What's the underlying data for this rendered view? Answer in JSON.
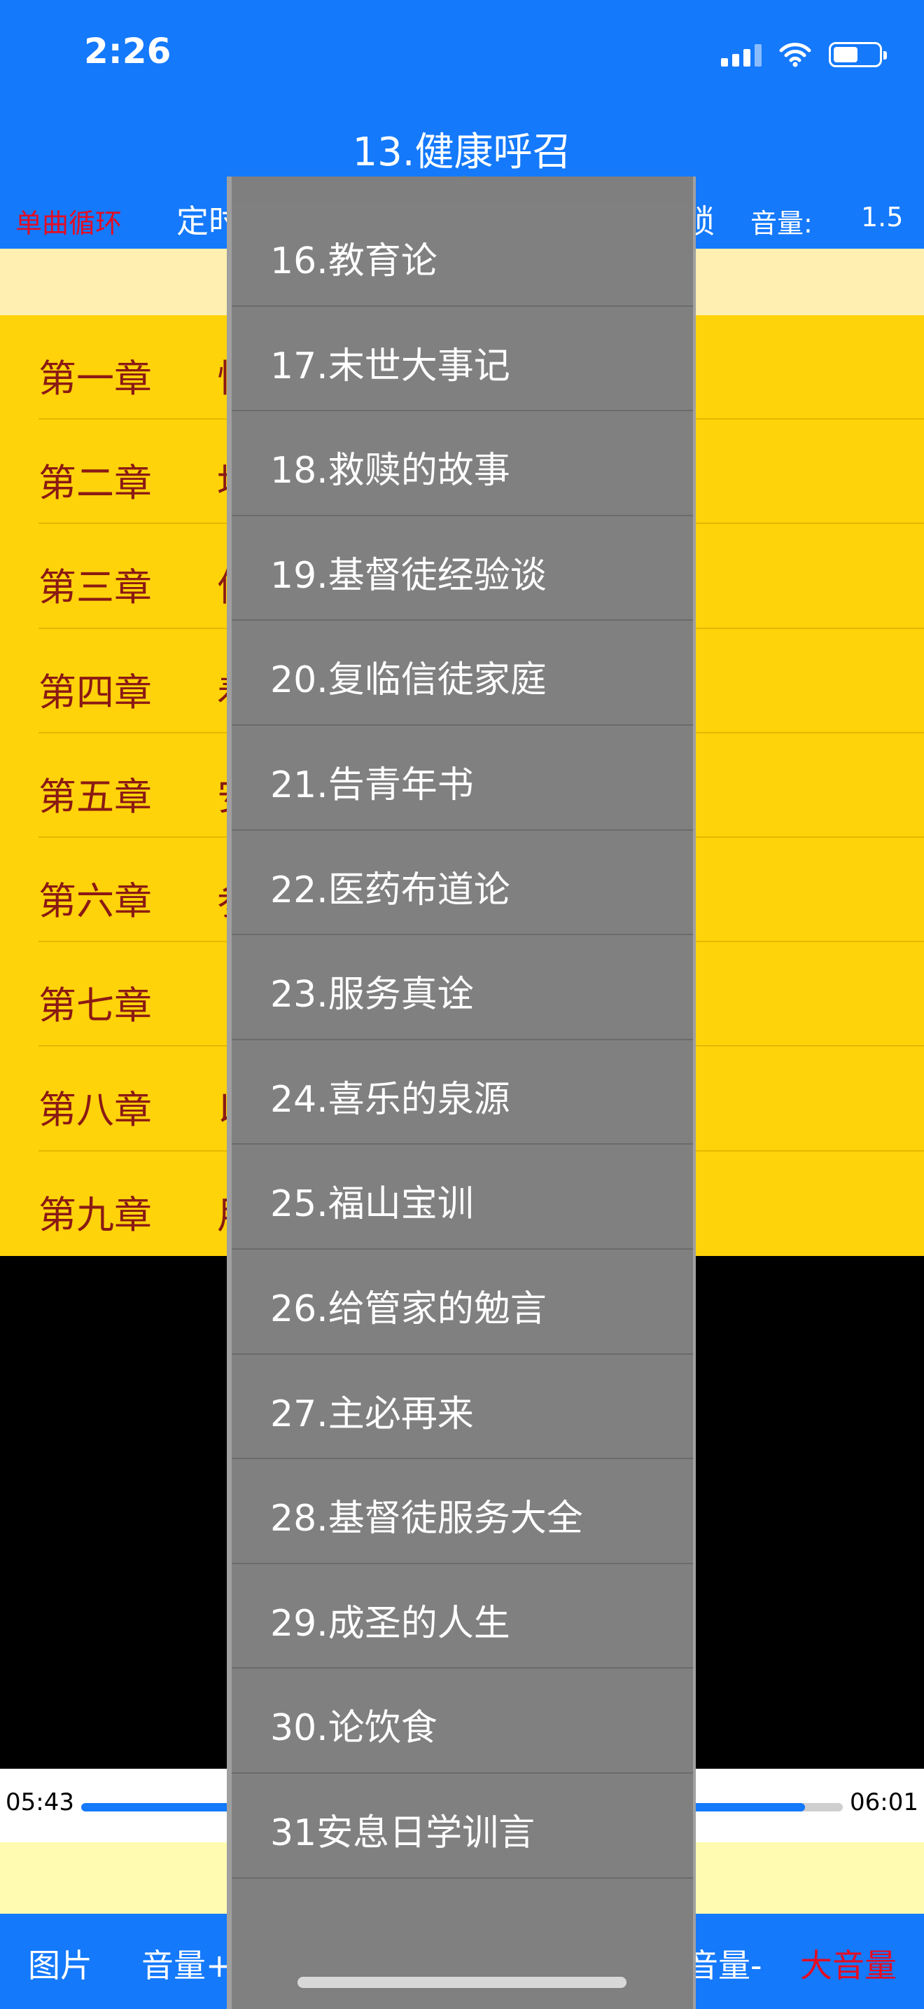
{
  "status_bar": {
    "time": "2:26"
  },
  "nav": {
    "title": "13.健康呼召"
  },
  "controls": {
    "loop_label": "单曲循环",
    "timer_label": "定时",
    "lock_label": "锁",
    "volume_label": "音量:",
    "volume_value": "1.5"
  },
  "chapters": [
    {
      "num": "第一章",
      "name": "恰"
    },
    {
      "num": "第二章",
      "name": "地"
    },
    {
      "num": "第三章",
      "name": "信"
    },
    {
      "num": "第四章",
      "name": "着"
    },
    {
      "num": "第五章",
      "name": "安"
    },
    {
      "num": "第六章",
      "name": "参"
    },
    {
      "num": "第七章",
      "name": ""
    },
    {
      "num": "第八章",
      "name": "以"
    },
    {
      "num": "第九章",
      "name": "用"
    }
  ],
  "player": {
    "current_time": "05:43",
    "total_time": "06:01",
    "progress_fraction": 0.95
  },
  "bottom_bar": {
    "pictures": "图片",
    "volume_up": "音量+",
    "volume_down": "音量-",
    "loud_volume": "大音量"
  },
  "dropdown_items": [
    "16.教育论",
    "17.末世大事记",
    "18.救赎的故事",
    "19.基督徒经验谈",
    "20.复临信徒家庭",
    "21.告青年书",
    "22.医药布道论",
    "23.服务真诠",
    "24.喜乐的泉源",
    "25.福山宝训",
    "26.给管家的勉言",
    "27.主必再来",
    "28.基督徒服务大全",
    "29.成圣的人生",
    "30.论饮食",
    "31安息日学训言",
    ""
  ],
  "colors": {
    "header_blue": "#1479FB",
    "chapter_bg": "#FFD30A",
    "chapter_text": "#8A1A14",
    "accent_red": "#E30D24",
    "menu_gray": "#808080"
  }
}
